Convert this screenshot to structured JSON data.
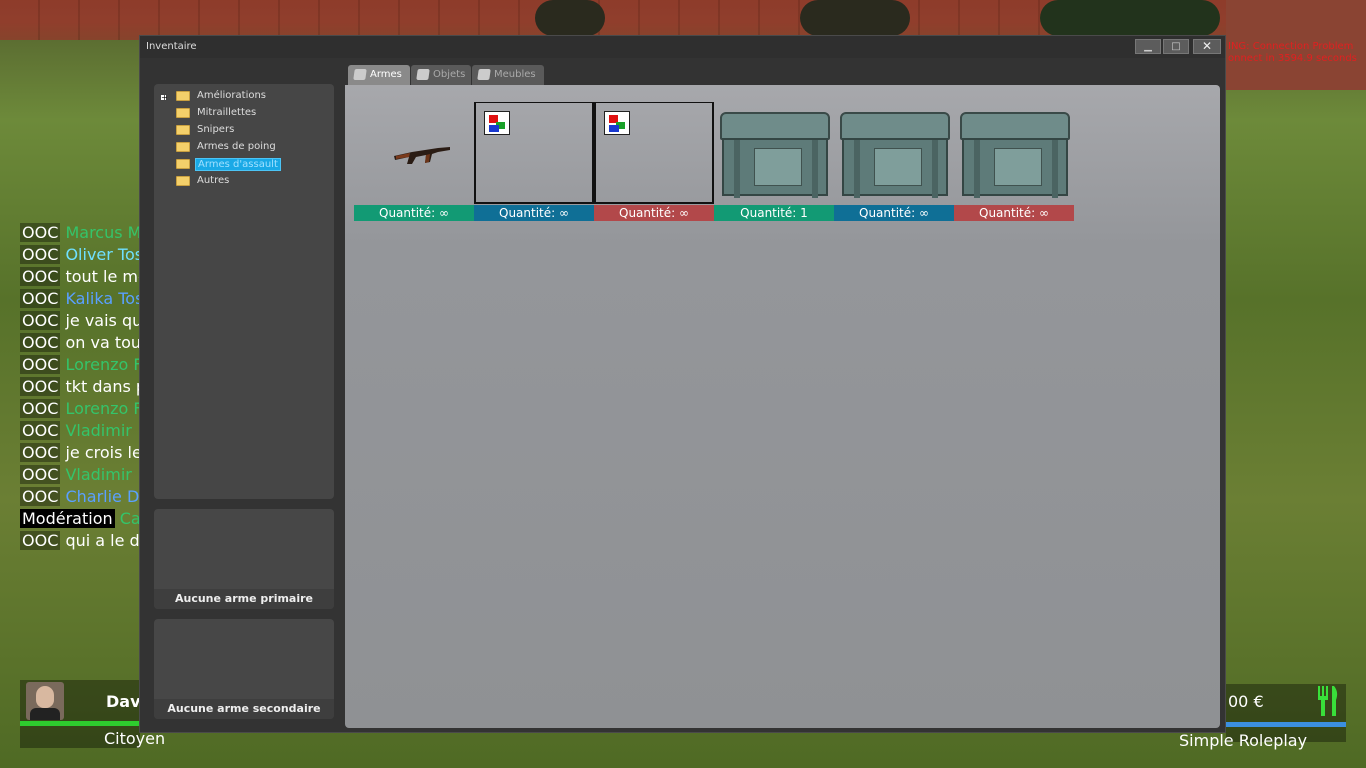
{
  "window": {
    "title": "Inventaire",
    "minimize_glyph": "▁",
    "maximize_glyph": "□",
    "close_glyph": "✕"
  },
  "tabs": [
    {
      "label": "Armes",
      "active": true
    },
    {
      "label": "Objets",
      "active": false
    },
    {
      "label": "Meubles",
      "active": false
    }
  ],
  "categories": [
    {
      "label": "Améliorations",
      "expandable": true,
      "expander_glyph": "+"
    },
    {
      "label": "Mitraillettes"
    },
    {
      "label": "Snipers"
    },
    {
      "label": "Armes de poing"
    },
    {
      "label": "Armes d'assault",
      "selected": true
    },
    {
      "label": "Autres"
    }
  ],
  "slots": {
    "primary": "Aucune arme primaire",
    "secondary": "Aucune arme secondaire"
  },
  "items": [
    {
      "image": "ak47-icon",
      "quantity": "Quantité: ∞",
      "color": "#129a74"
    },
    {
      "image": "missing-image-icon",
      "quantity": "Quantité: ∞",
      "color": "#0f6f96"
    },
    {
      "image": "missing-image-icon",
      "quantity": "Quantité: ∞",
      "color": "#b2484a"
    },
    {
      "image": "ammo-crate-icon",
      "quantity": "Quantité: 1",
      "color": "#129a74"
    },
    {
      "image": "ammo-crate-icon",
      "quantity": "Quantité: ∞",
      "color": "#0f6f96"
    },
    {
      "image": "ammo-crate-icon",
      "quantity": "Quantité: ∞",
      "color": "#b2484a"
    }
  ],
  "chat": [
    {
      "tag": "OOC",
      "name": "Marcus M",
      "msg": "",
      "name_color": "green"
    },
    {
      "tag": "OOC",
      "name": "Oliver Tos",
      "msg": "",
      "name_color": "cyan"
    },
    {
      "tag": "OOC",
      "name": "",
      "msg": "tout le mo"
    },
    {
      "tag": "OOC",
      "name": "Kalika Tos",
      "msg": "",
      "name_color": "blue"
    },
    {
      "tag": "OOC",
      "name": "",
      "msg": "je vais qui"
    },
    {
      "tag": "OOC",
      "name": "",
      "msg": "on va tous"
    },
    {
      "tag": "OOC",
      "name": "Lorenzo F",
      "msg": "",
      "name_color": "green"
    },
    {
      "tag": "OOC",
      "name": "",
      "msg": "tkt dans p"
    },
    {
      "tag": "OOC",
      "name": "Lorenzo F",
      "msg": "",
      "name_color": "green"
    },
    {
      "tag": "OOC",
      "name": "Vladimir",
      "msg": "",
      "name_color": "green"
    },
    {
      "tag": "OOC",
      "name": "",
      "msg": "je crois le"
    },
    {
      "tag": "OOC",
      "name": "Vladimir",
      "msg": "",
      "name_color": "green"
    },
    {
      "tag": "OOC",
      "name": "Charlie D",
      "msg": "",
      "name_color": "blue"
    },
    {
      "tag": "Modération",
      "name": "Ca",
      "msg": "",
      "name_color": "green",
      "mod": true
    },
    {
      "tag": "OOC",
      "name": "",
      "msg": "qui a le di"
    }
  ],
  "warning": {
    "line1": "ING: Connection Problem",
    "line2": "onnect in 3594.9 seconds"
  },
  "hud": {
    "name": "Davi",
    "job": "Citoyen",
    "money": "00 €",
    "server": "Simple Roleplay",
    "food_icon": "fork-knife-icon"
  }
}
